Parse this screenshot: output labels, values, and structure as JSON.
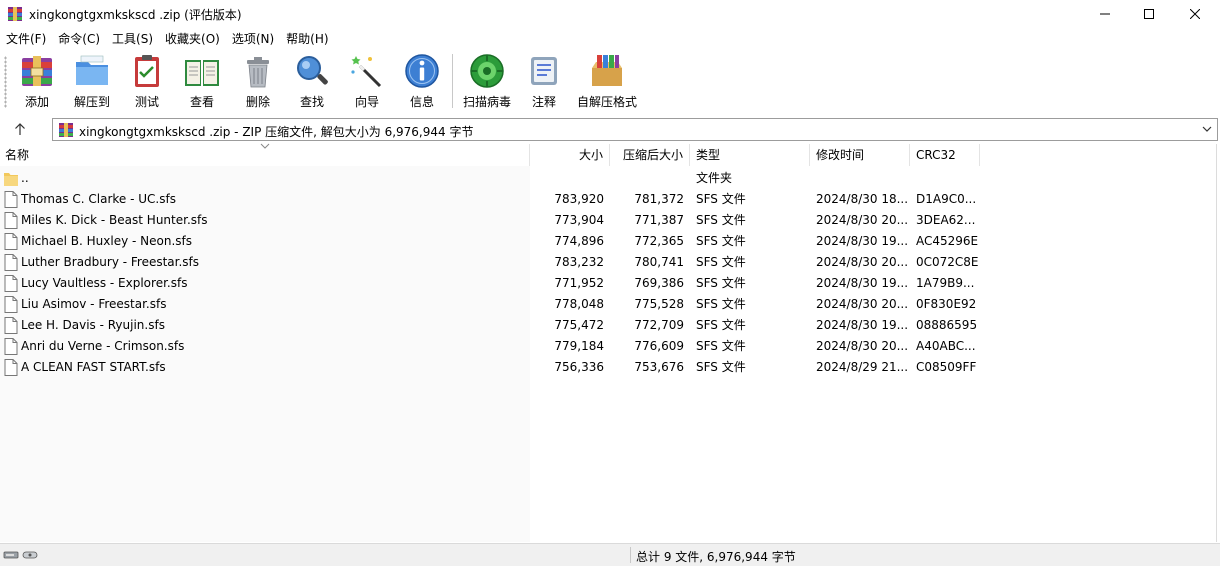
{
  "window": {
    "title": "xingkongtgxmkskscd .zip (评估版本)",
    "controls": {
      "minimize_icon": "minimize-icon",
      "maximize_icon": "maximize-icon",
      "close_icon": "close-icon"
    }
  },
  "menu": [
    "文件(F)",
    "命令(C)",
    "工具(S)",
    "收藏夹(O)",
    "选项(N)",
    "帮助(H)"
  ],
  "toolbar": [
    {
      "label": "添加",
      "icon": "add-archive-icon"
    },
    {
      "label": "解压到",
      "icon": "extract-to-icon"
    },
    {
      "label": "测试",
      "icon": "test-icon"
    },
    {
      "label": "查看",
      "icon": "view-icon"
    },
    {
      "label": "删除",
      "icon": "delete-icon"
    },
    {
      "label": "查找",
      "icon": "find-icon"
    },
    {
      "label": "向导",
      "icon": "wizard-icon"
    },
    {
      "label": "信息",
      "icon": "info-icon"
    },
    {
      "label": "扫描病毒",
      "icon": "virus-scan-icon"
    },
    {
      "label": "注释",
      "icon": "comment-icon"
    },
    {
      "label": "自解压格式",
      "icon": "sfx-icon"
    }
  ],
  "address": {
    "text": "xingkongtgxmkskscd .zip - ZIP 压缩文件, 解包大小为 6,976,944 字节"
  },
  "columns": {
    "name": "名称",
    "size": "大小",
    "packed": "压缩后大小",
    "type": "类型",
    "modified": "修改时间",
    "crc": "CRC32"
  },
  "files": [
    {
      "name": "..",
      "size": "",
      "packed": "",
      "type": "文件夹",
      "modified": "",
      "crc": "",
      "kind": "folder"
    },
    {
      "name": "Thomas C. Clarke - UC.sfs",
      "size": "783,920",
      "packed": "781,372",
      "type": "SFS 文件",
      "modified": "2024/8/30 18...",
      "crc": "D1A9C0...",
      "kind": "file"
    },
    {
      "name": "Miles K. Dick - Beast Hunter.sfs",
      "size": "773,904",
      "packed": "771,387",
      "type": "SFS 文件",
      "modified": "2024/8/30 20...",
      "crc": "3DEA62...",
      "kind": "file"
    },
    {
      "name": "Michael B. Huxley - Neon.sfs",
      "size": "774,896",
      "packed": "772,365",
      "type": "SFS 文件",
      "modified": "2024/8/30 19...",
      "crc": "AC45296E",
      "kind": "file"
    },
    {
      "name": "Luther Bradbury - Freestar.sfs",
      "size": "783,232",
      "packed": "780,741",
      "type": "SFS 文件",
      "modified": "2024/8/30 20...",
      "crc": "0C072C8E",
      "kind": "file"
    },
    {
      "name": "Lucy Vaultless - Explorer.sfs",
      "size": "771,952",
      "packed": "769,386",
      "type": "SFS 文件",
      "modified": "2024/8/30 19...",
      "crc": "1A79B9...",
      "kind": "file"
    },
    {
      "name": "Liu Asimov - Freestar.sfs",
      "size": "778,048",
      "packed": "775,528",
      "type": "SFS 文件",
      "modified": "2024/8/30 20...",
      "crc": "0F830E92",
      "kind": "file"
    },
    {
      "name": "Lee H. Davis - Ryujin.sfs",
      "size": "775,472",
      "packed": "772,709",
      "type": "SFS 文件",
      "modified": "2024/8/30 19...",
      "crc": "08886595",
      "kind": "file"
    },
    {
      "name": "Anri du Verne - Crimson.sfs",
      "size": "779,184",
      "packed": "776,609",
      "type": "SFS 文件",
      "modified": "2024/8/30 20...",
      "crc": "A40ABC...",
      "kind": "file"
    },
    {
      "name": "A CLEAN FAST START.sfs",
      "size": "756,336",
      "packed": "753,676",
      "type": "SFS 文件",
      "modified": "2024/8/29 21...",
      "crc": "C08509FF",
      "kind": "file"
    }
  ],
  "status": {
    "summary": "总计 9 文件, 6,976,944 字节"
  }
}
